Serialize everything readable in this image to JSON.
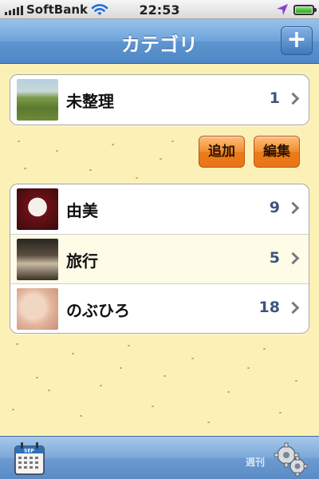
{
  "status": {
    "carrier": "SoftBank",
    "time": "22:53"
  },
  "nav": {
    "title": "カテゴリ",
    "add_label": "+"
  },
  "uncategorized": {
    "label": "未整理",
    "count": "1"
  },
  "actions": {
    "add_label": "追加",
    "edit_label": "編集"
  },
  "categories": [
    {
      "label": "由美",
      "count": "9"
    },
    {
      "label": "旅行",
      "count": "5"
    },
    {
      "label": "のぶひろ",
      "count": "18"
    }
  ],
  "toolbar": {
    "weekly_label": "週刊",
    "calendar_month": "SEP"
  },
  "colors": {
    "nav": "#5e95cf",
    "background": "#fbf1b7",
    "button": "#f48c2d",
    "count": "#3d5580"
  }
}
